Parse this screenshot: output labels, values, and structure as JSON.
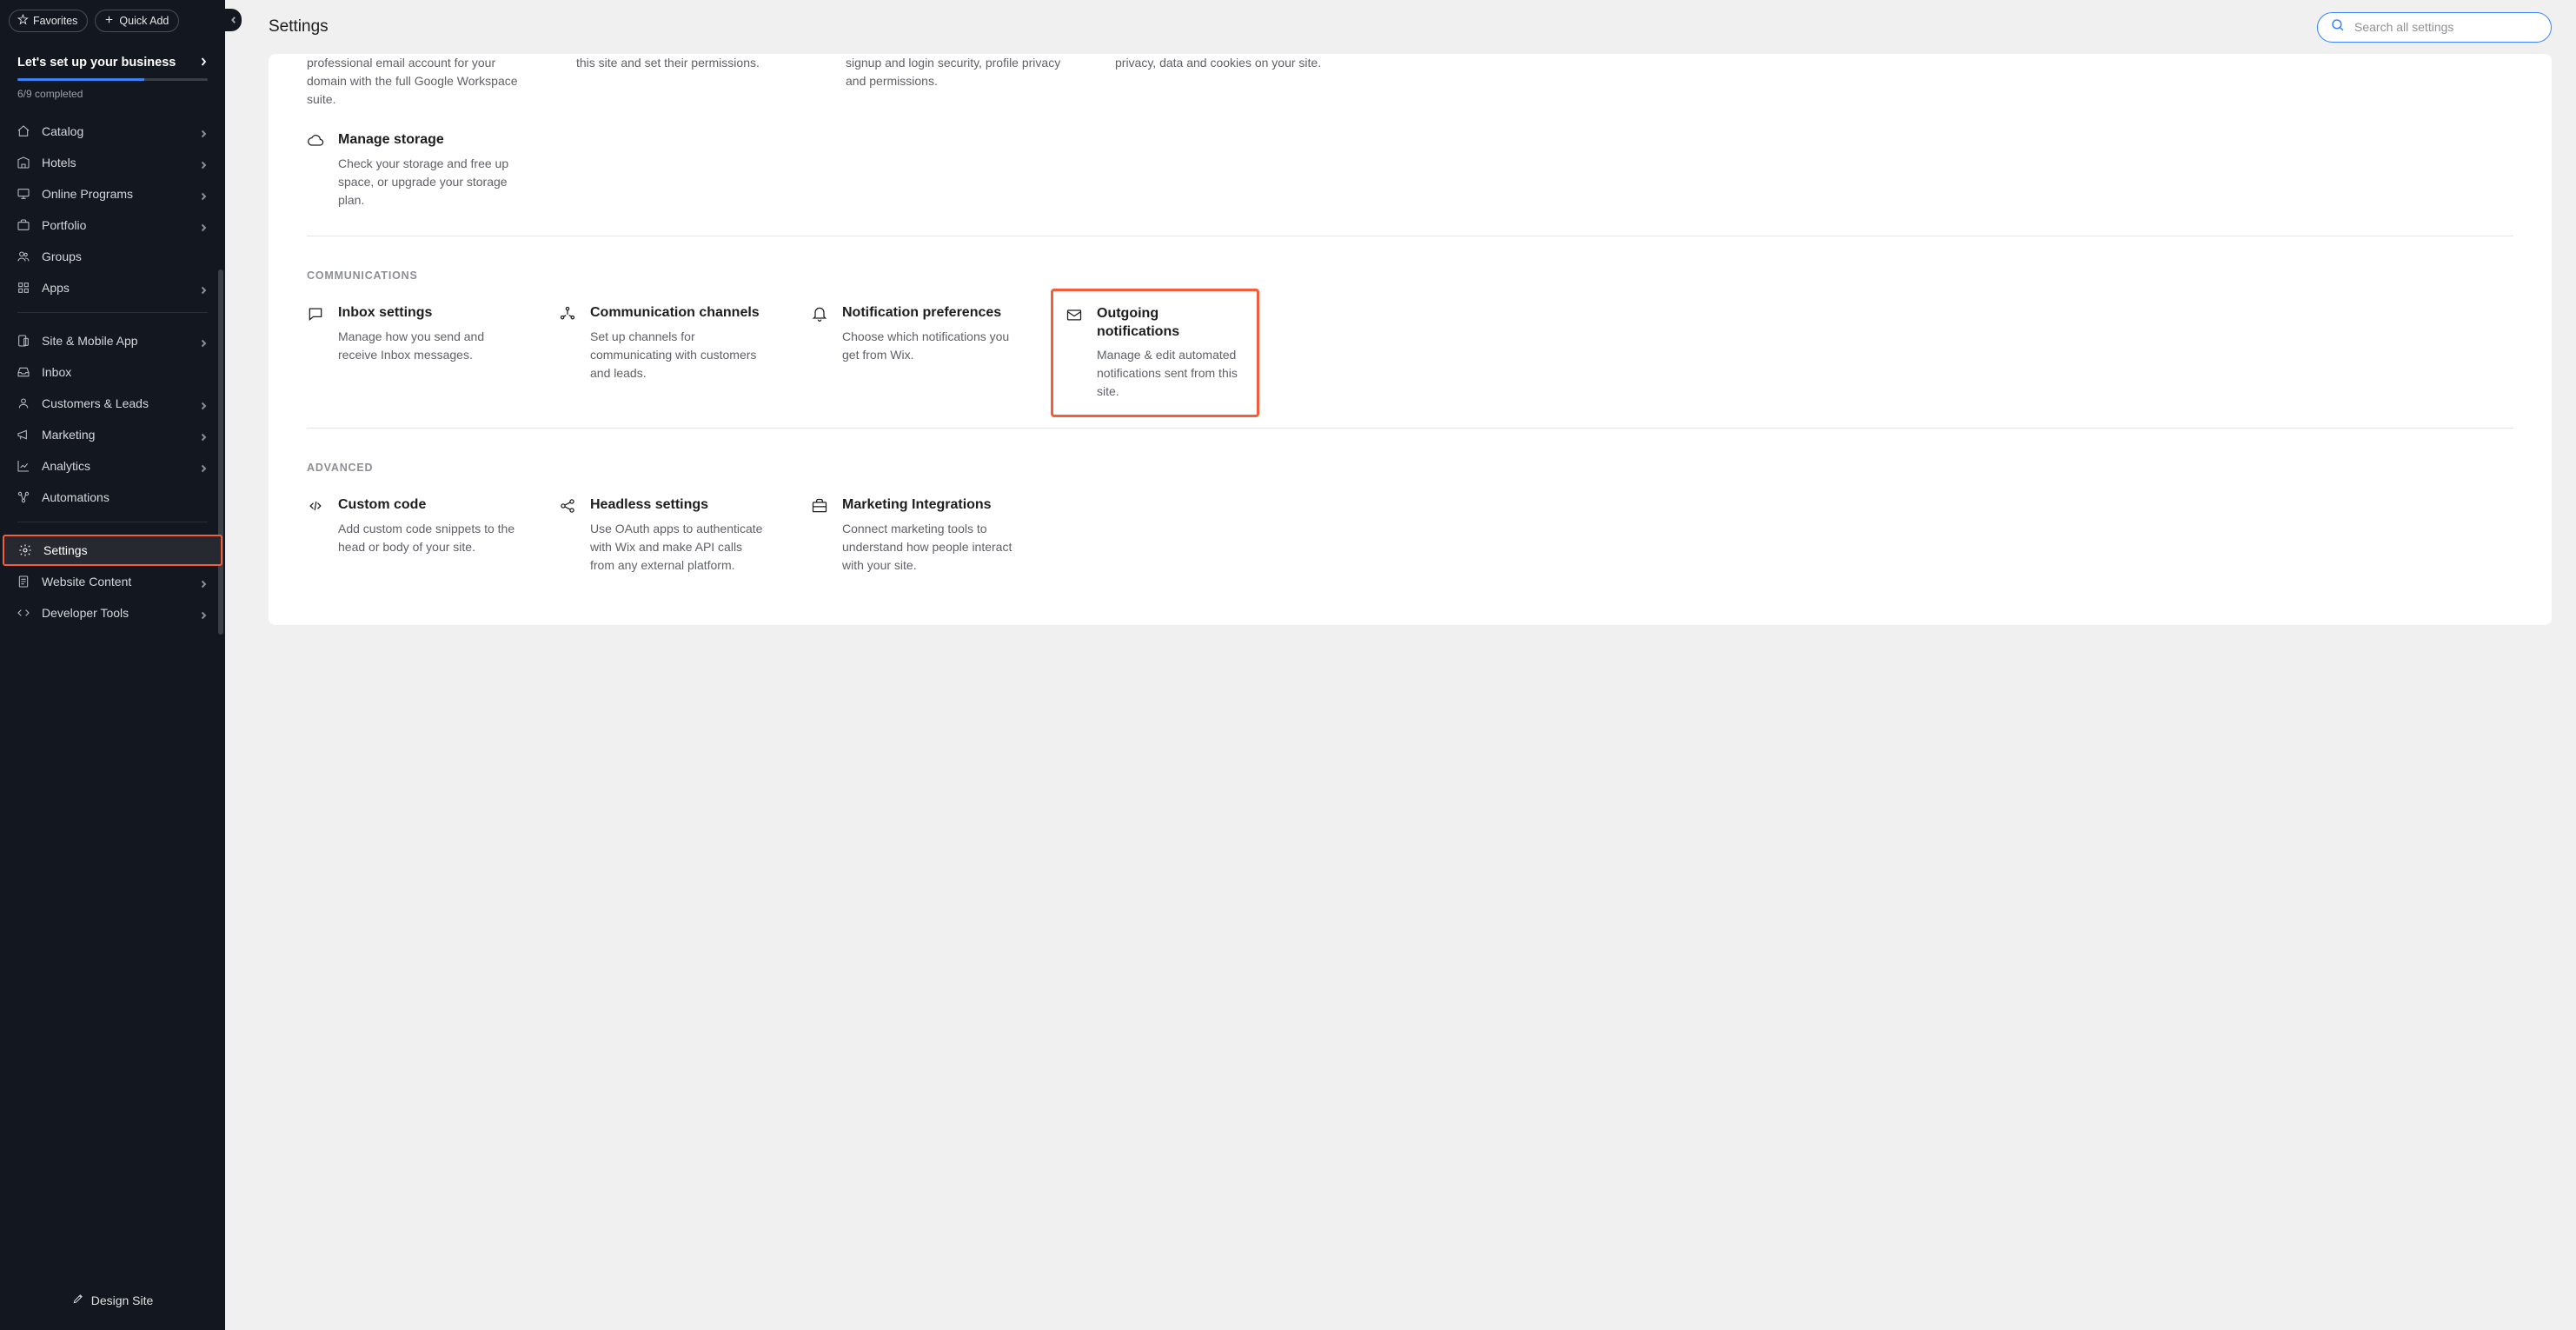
{
  "topbar": {
    "favorites": "Favorites",
    "quick_add": "Quick Add"
  },
  "setup": {
    "title": "Let's set up your business",
    "progress_text": "6/9 completed",
    "progress_percent": 66.6
  },
  "sidebar": {
    "group1": [
      {
        "icon": "tag",
        "label": "Catalog",
        "chevron": true
      },
      {
        "icon": "hotel",
        "label": "Hotels",
        "chevron": true
      },
      {
        "icon": "monitor",
        "label": "Online Programs",
        "chevron": true
      },
      {
        "icon": "briefcase",
        "label": "Portfolio",
        "chevron": true
      },
      {
        "icon": "users",
        "label": "Groups",
        "chevron": false
      },
      {
        "icon": "grid",
        "label": "Apps",
        "chevron": true
      }
    ],
    "group2": [
      {
        "icon": "mobile",
        "label": "Site & Mobile App",
        "chevron": true
      },
      {
        "icon": "inbox",
        "label": "Inbox",
        "chevron": false
      },
      {
        "icon": "person",
        "label": "Customers & Leads",
        "chevron": true
      },
      {
        "icon": "megaphone",
        "label": "Marketing",
        "chevron": true
      },
      {
        "icon": "chart",
        "label": "Analytics",
        "chevron": true
      },
      {
        "icon": "flow",
        "label": "Automations",
        "chevron": false
      }
    ],
    "group3": [
      {
        "icon": "gear",
        "label": "Settings",
        "chevron": false,
        "active": true,
        "highlighted": true
      },
      {
        "icon": "doc",
        "label": "Website Content",
        "chevron": true
      },
      {
        "icon": "code",
        "label": "Developer Tools",
        "chevron": true
      }
    ],
    "design": "Design Site"
  },
  "page": {
    "title": "Settings",
    "search_placeholder": "Search all settings"
  },
  "partial": {
    "c1": "professional email account for your domain with the full Google Workspace suite.",
    "c2": "this site and set their permissions.",
    "c3": "signup and login security, profile privacy and permissions.",
    "c4": "privacy, data and cookies on your site."
  },
  "storage": {
    "title": "Manage storage",
    "desc": "Check your storage and free up space, or upgrade your storage plan."
  },
  "sections": {
    "comm": {
      "heading": "Communications",
      "cards": [
        {
          "icon": "chat",
          "title": "Inbox settings",
          "desc": "Manage how you send and receive Inbox messages."
        },
        {
          "icon": "share",
          "title": "Communication channels",
          "desc": "Set up channels for communicating with customers and leads."
        },
        {
          "icon": "bell",
          "title": "Notification preferences",
          "desc": "Choose which notifications you get from Wix."
        },
        {
          "icon": "mail",
          "title": "Outgoing notifications",
          "desc": "Manage & edit automated notifications sent from this site.",
          "highlighted": true
        }
      ]
    },
    "adv": {
      "heading": "Advanced",
      "cards": [
        {
          "icon": "codebox",
          "title": "Custom code",
          "desc": "Add custom code snippets to the head or body of your site."
        },
        {
          "icon": "headless",
          "title": "Headless settings",
          "desc": "Use OAuth apps to authenticate with Wix and make API calls from any external platform."
        },
        {
          "icon": "brief2",
          "title": "Marketing Integrations",
          "desc": "Connect marketing tools to understand how people interact with your site."
        }
      ]
    }
  }
}
